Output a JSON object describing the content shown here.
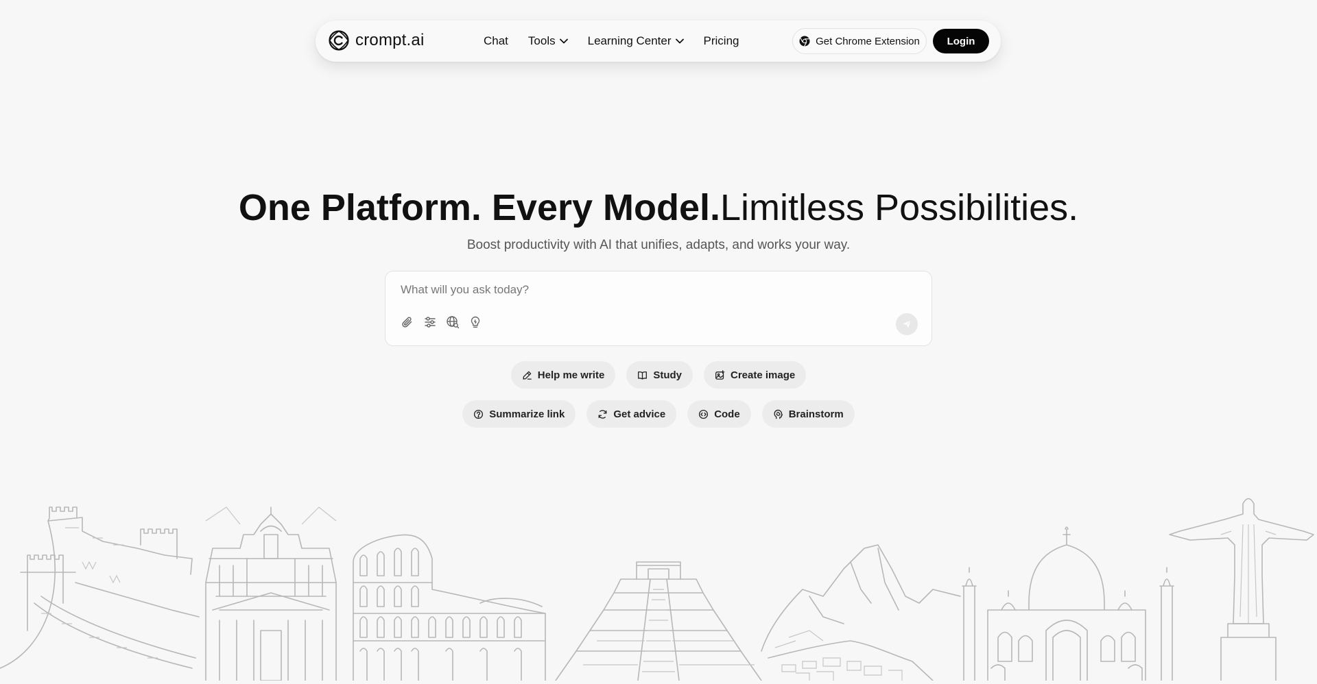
{
  "nav": {
    "brand": "crompt.ai",
    "links": [
      {
        "label": "Chat",
        "has_dropdown": false
      },
      {
        "label": "Tools",
        "has_dropdown": true
      },
      {
        "label": "Learning Center",
        "has_dropdown": true
      },
      {
        "label": "Pricing",
        "has_dropdown": false
      }
    ],
    "chrome_extension_label": "Get Chrome Extension",
    "login_label": "Login"
  },
  "hero": {
    "title_bold": "One Platform. Every Model.",
    "title_light": "Limitless Possibilities.",
    "subtitle": "Boost productivity with AI that unifies, adapts, and works your way."
  },
  "chat": {
    "placeholder": "What will you ask today?",
    "value": "",
    "tool_icons": [
      "paperclip-icon",
      "sliders-icon",
      "web-search-icon",
      "lightbulb-icon"
    ],
    "send_icon": "send-icon"
  },
  "suggestions": {
    "row1": [
      {
        "label": "Help me write",
        "icon": "pencil-icon"
      },
      {
        "label": "Study",
        "icon": "book-icon"
      },
      {
        "label": "Create image",
        "icon": "image-icon"
      }
    ],
    "row2": [
      {
        "label": "Summarize link",
        "icon": "summarize-icon"
      },
      {
        "label": "Get advice",
        "icon": "advice-icon"
      },
      {
        "label": "Code",
        "icon": "code-icon"
      },
      {
        "label": "Brainstorm",
        "icon": "brain-icon"
      }
    ]
  },
  "colors": {
    "background": "#f7f7f7",
    "login_button": "#050505",
    "chip_background": "#ececec",
    "illustration_stroke": "#b7b7b7"
  },
  "illustration": {
    "landmarks": [
      "great-wall",
      "petra",
      "colosseum",
      "chichen-itza",
      "machu-picchu",
      "taj-mahal",
      "christ-the-redeemer"
    ]
  }
}
